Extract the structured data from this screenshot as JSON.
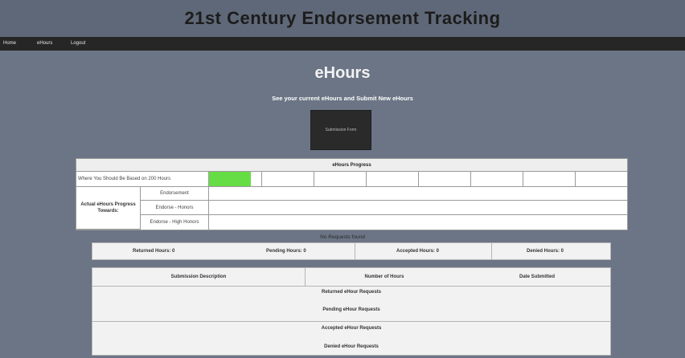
{
  "header": {
    "title": "21st Century Endorsement Tracking"
  },
  "nav": {
    "items": [
      "Home",
      "eHours",
      "Logout"
    ]
  },
  "page": {
    "heading": "eHours",
    "subheading": "See your current eHours and Submit New eHours",
    "submit_button": "Submission Form"
  },
  "progress": {
    "title": "eHours Progress",
    "should_be_label": "Where You Should Be Based on 200 Hours",
    "should_be_fraction": 0.1,
    "fill_color": "#66dd44",
    "actual_label": "Actual eHours Progress Towards:",
    "rows": [
      "Endorsement",
      "Endorse - Honors",
      "Endorse - High Honors"
    ]
  },
  "requests_status": "No Requests found",
  "summary": {
    "returned": "Returned Hours: 0",
    "pending": "Pending Hours: 0",
    "accepted": "Accepted Hours: 0",
    "denied": "Denied Hours: 0"
  },
  "requests_table": {
    "headers": [
      "Submission Description",
      "Number of Hours",
      "Date Submitted"
    ],
    "sections": [
      "Returned eHour Requests",
      "Pending eHour Requests",
      "Accepted eHour Requests",
      "Denied eHour Requests"
    ]
  }
}
